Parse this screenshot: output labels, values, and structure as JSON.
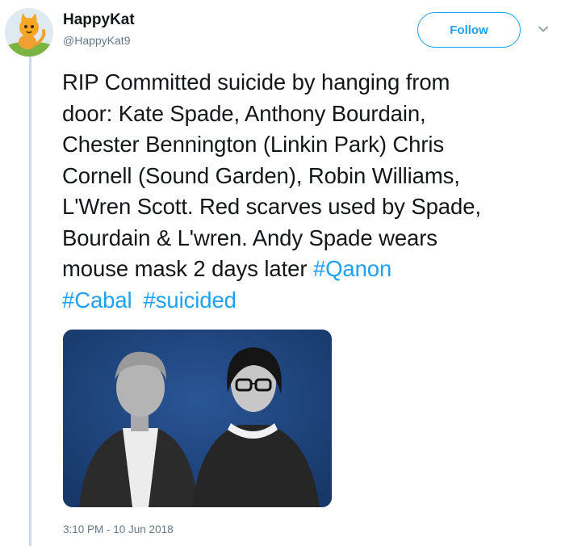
{
  "user": {
    "display_name": "HappyKat",
    "handle": "@HappyKat9"
  },
  "follow_button": {
    "label": "Follow"
  },
  "tweet": {
    "text_lines": [
      "RIP Committed suicide by hanging from",
      "door: Kate Spade, Anthony Bourdain,",
      "Chester Bennington (Linkin Park) Chris",
      "Cornell (Sound Garden), Robin Williams,",
      "L'Wren Scott. Red scarves used by Spade,",
      "Bourdain & L'wren. Andy Spade wears",
      "mouse mask 2 days later "
    ],
    "hashtags": [
      "#Qanon",
      "#Cabal",
      "#suicided"
    ],
    "timestamp": "3:10 PM - 10 Jun 2018"
  },
  "colors": {
    "accent": "#1da1f2",
    "media_background": "#1e4278",
    "thread_line": "#cfd9e8"
  },
  "icons": {
    "avatar": "cat-avatar-icon",
    "menu": "chevron-down-icon"
  }
}
